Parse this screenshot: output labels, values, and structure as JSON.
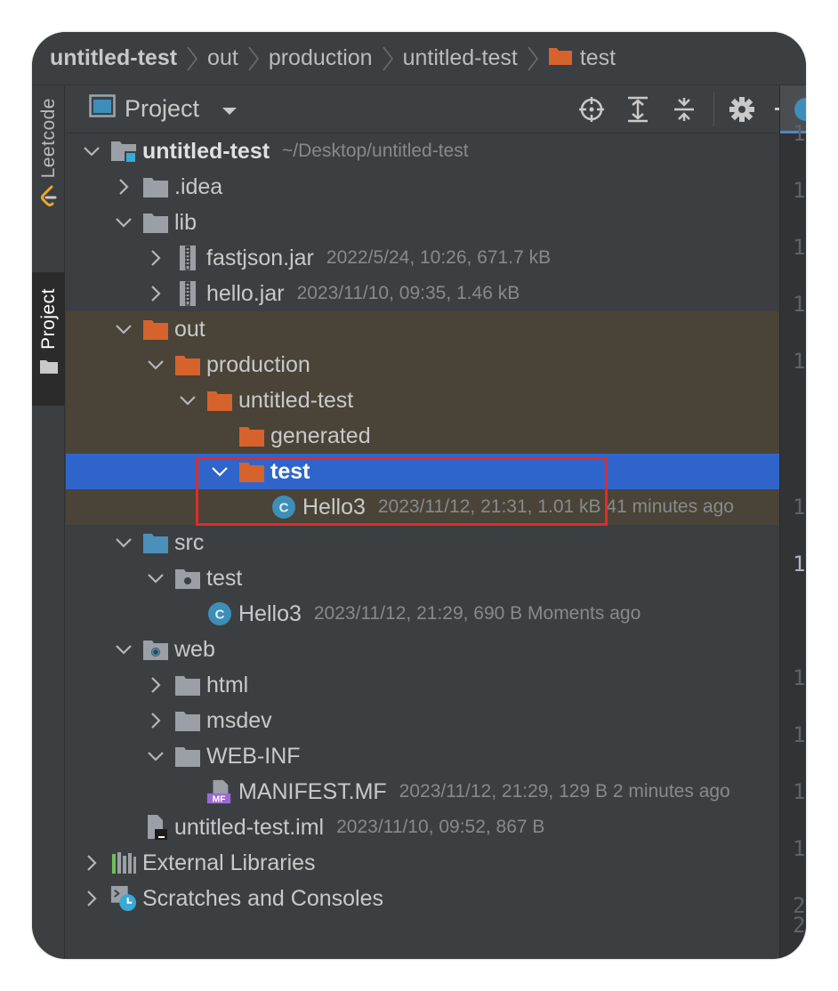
{
  "breadcrumb": {
    "items": [
      "untitled-test",
      "out",
      "production",
      "untitled-test",
      "test"
    ]
  },
  "tool_strip": {
    "tabs": [
      "Leetcode",
      "Project"
    ],
    "active": "Project"
  },
  "panel": {
    "title": "Project",
    "tools": [
      "locate-icon",
      "expand-all-icon",
      "collapse-all-icon",
      "gear-icon",
      "minimize-icon"
    ]
  },
  "tree": [
    {
      "name": "untitled-test",
      "meta": "~/Desktop/untitled-test",
      "depth": 0,
      "chevron": "down",
      "icon": "module-folder",
      "bold": true
    },
    {
      "name": ".idea",
      "meta": "",
      "depth": 1,
      "chevron": "right",
      "icon": "folder-gray"
    },
    {
      "name": "lib",
      "meta": "",
      "depth": 1,
      "chevron": "down",
      "icon": "folder-gray"
    },
    {
      "name": "fastjson.jar",
      "meta": "2022/5/24, 10:26, 671.7 kB",
      "depth": 2,
      "chevron": "right",
      "icon": "jar"
    },
    {
      "name": "hello.jar",
      "meta": "2023/11/10, 09:35, 1.46 kB",
      "depth": 2,
      "chevron": "right",
      "icon": "jar"
    },
    {
      "name": "out",
      "meta": "",
      "depth": 1,
      "chevron": "down",
      "icon": "folder-orange",
      "excluded": true
    },
    {
      "name": "production",
      "meta": "",
      "depth": 2,
      "chevron": "down",
      "icon": "folder-orange",
      "excluded": true
    },
    {
      "name": "untitled-test",
      "meta": "",
      "depth": 3,
      "chevron": "down",
      "icon": "folder-orange",
      "excluded": true
    },
    {
      "name": "generated",
      "meta": "",
      "depth": 4,
      "chevron": "none",
      "icon": "folder-orange",
      "excluded": true
    },
    {
      "name": "test",
      "meta": "",
      "depth": 4,
      "chevron": "down",
      "icon": "folder-orange",
      "selected": true
    },
    {
      "name": "Hello3",
      "meta": "2023/11/12, 21:31, 1.01 kB 41 minutes ago",
      "depth": 5,
      "chevron": "none",
      "icon": "class",
      "excluded": true
    },
    {
      "name": "src",
      "meta": "",
      "depth": 1,
      "chevron": "down",
      "icon": "folder-blue"
    },
    {
      "name": "test",
      "meta": "",
      "depth": 2,
      "chevron": "down",
      "icon": "folder-package"
    },
    {
      "name": "Hello3",
      "meta": "2023/11/12, 21:29, 690 B Moments ago",
      "depth": 3,
      "chevron": "none",
      "icon": "class"
    },
    {
      "name": "web",
      "meta": "",
      "depth": 1,
      "chevron": "down",
      "icon": "folder-web"
    },
    {
      "name": "html",
      "meta": "",
      "depth": 2,
      "chevron": "right",
      "icon": "folder-gray"
    },
    {
      "name": "msdev",
      "meta": "",
      "depth": 2,
      "chevron": "right",
      "icon": "folder-gray"
    },
    {
      "name": "WEB-INF",
      "meta": "",
      "depth": 2,
      "chevron": "down",
      "icon": "folder-gray"
    },
    {
      "name": "MANIFEST.MF",
      "meta": "2023/11/12, 21:29, 129 B 2 minutes ago",
      "depth": 3,
      "chevron": "none",
      "icon": "manifest"
    },
    {
      "name": "untitled-test.iml",
      "meta": "2023/11/10, 09:52, 867 B",
      "depth": 1,
      "chevron": "none",
      "icon": "iml"
    },
    {
      "name": "External Libraries",
      "meta": "",
      "depth": 0,
      "chevron": "right",
      "icon": "libraries"
    },
    {
      "name": "Scratches and Consoles",
      "meta": "",
      "depth": 0,
      "chevron": "right",
      "icon": "scratches"
    }
  ],
  "editor_gutter": [
    "1",
    "1",
    "1",
    "1",
    "1",
    "1",
    "1",
    "1",
    "1",
    "1",
    "1",
    "2",
    "2"
  ],
  "colors": {
    "selection": "#2f65ca",
    "excluded": "#4a4337",
    "folder_orange": "#d5632b",
    "folder_gray": "#9aa0a6",
    "folder_blue": "#4a90b8",
    "class_icon": "#3d8eb9",
    "annotation_box": "#e02b2b"
  }
}
